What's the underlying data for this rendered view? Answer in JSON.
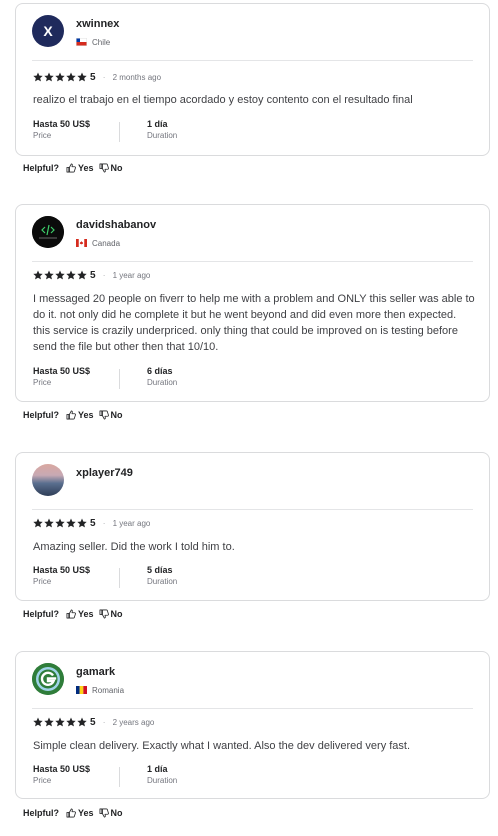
{
  "reviews": [
    {
      "avatar_letter": "X",
      "username": "xwinnex",
      "country": "Chile",
      "rating": "5",
      "time_ago": "2 months ago",
      "text": "realizo el trabajo en el tiempo acordado y estoy contento con el resultado final",
      "price_value": "Hasta 50 US$",
      "price_label": "Price",
      "duration_value": "1 día",
      "duration_label": "Duration"
    },
    {
      "username": "davidshabanov",
      "country": "Canada",
      "rating": "5",
      "time_ago": "1 year ago",
      "text": "I messaged 20 people on fiverr to help me with a problem and ONLY this seller was able to do it. not only did he complete it but he went beyond and did even more then expected. this service is crazily underpriced. only thing that could be improved on is testing before send the file but other then that 10/10.",
      "price_value": "Hasta 50 US$",
      "price_label": "Price",
      "duration_value": "6 días",
      "duration_label": "Duration"
    },
    {
      "username": "xplayer749",
      "rating": "5",
      "time_ago": "1 year ago",
      "text": "Amazing seller. Did the work I told him to.",
      "price_value": "Hasta 50 US$",
      "price_label": "Price",
      "duration_value": "5 días",
      "duration_label": "Duration"
    },
    {
      "username": "gamark",
      "country": "Romania",
      "rating": "5",
      "time_ago": "2 years ago",
      "text": "Simple clean delivery. Exactly what I wanted. Also the dev delivered very fast.",
      "price_value": "Hasta 50 US$",
      "price_label": "Price",
      "duration_value": "1 día",
      "duration_label": "Duration"
    }
  ],
  "helpful": {
    "label": "Helpful?",
    "yes": "Yes",
    "no": "No"
  },
  "icons": {
    "star": "star-icon",
    "thumbs_up": "thumbs-up-icon",
    "thumbs_down": "thumbs-down-icon"
  },
  "colors": {
    "star": "#222325",
    "avatar_x": "#1f2a5c",
    "border": "#dadbdd"
  }
}
